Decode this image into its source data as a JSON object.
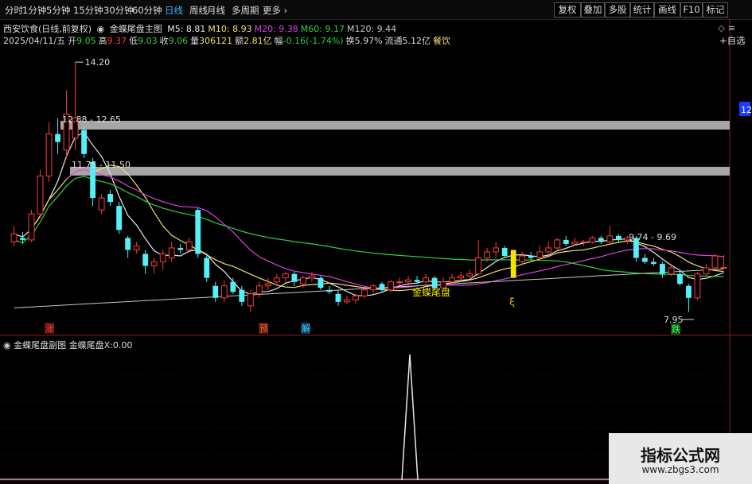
{
  "topbar": {
    "timeframes": [
      {
        "label": "分时",
        "active": false
      },
      {
        "label": "1分钟",
        "active": false
      },
      {
        "label": "5分钟",
        "active": false
      },
      {
        "label": "15分钟",
        "active": false
      },
      {
        "label": "30分钟",
        "active": false
      },
      {
        "label": "60分钟",
        "active": false
      },
      {
        "label": "日线",
        "active": true
      },
      {
        "label": "周线",
        "active": false
      },
      {
        "label": "月线",
        "active": false
      },
      {
        "label": "多周期",
        "active": false
      },
      {
        "label": "更多",
        "active": false
      }
    ],
    "buttons": [
      "复权",
      "叠加",
      "多股",
      "统计",
      "画线",
      "F10",
      "标记"
    ],
    "add_watch": "+自选"
  },
  "info": {
    "stock": "西安饮食(日线,前复权)",
    "indicator_main": "金蝶尾盘主图",
    "ma": [
      {
        "label": "M5:",
        "value": "8.81",
        "color": "#e8e8e8"
      },
      {
        "label": "M10:",
        "value": "8.93",
        "color": "#f0e070"
      },
      {
        "label": "M20:",
        "value": "9.38",
        "color": "#e040e0"
      },
      {
        "label": "M60:",
        "value": "9.17",
        "color": "#30d040"
      },
      {
        "label": "M120:",
        "value": "9.44",
        "color": "#c8c8c8"
      }
    ],
    "date": "2025/04/11/五",
    "open_label": "开",
    "open": "9.05",
    "high_label": "高",
    "high": "9.37",
    "low_label": "低",
    "low": "9.03",
    "close_label": "收",
    "close": "9.06",
    "vol_label": "量",
    "vol": "306121",
    "amt_label": "额",
    "amt": "2.81亿",
    "chg_label": "幅",
    "chg": "-0.16(-1.74%)",
    "turn_label": "换",
    "turn": "5.97%",
    "float_label": "流通",
    "float": "5.12亿",
    "sector": "餐饮"
  },
  "sub": {
    "title": "金蝶尾盘副图",
    "var": "金蝶尾盘X:",
    "value": "0.00"
  },
  "annotations": {
    "high_price": "14.20",
    "band1": "12.88 - 12.65",
    "band2": "11.75 - 11.50",
    "band3": "9.74 - 9.69",
    "low_price": "7.95",
    "signal": "金蝶尾盘",
    "tag_zhang": "涨",
    "tag_yu": "预",
    "tag_jie": "解",
    "tag_die": "跌",
    "right_axis": "12"
  },
  "colors": {
    "up": "#ff3b3b",
    "down": "#54f0f8",
    "band": "#a6a6a6",
    "ma5": "#e8e8e8",
    "ma10": "#f0e070",
    "ma20": "#e040e0",
    "ma60": "#30d040",
    "ma120": "#c8c8c8"
  },
  "watermark": {
    "line1": "指标公式网",
    "line2": "www.zbgs3.com"
  },
  "chart_data": {
    "type": "candlestick",
    "ylim": [
      7.6,
      14.6
    ],
    "candles": [
      [
        9.7,
        9.9,
        9.6,
        10.1
      ],
      [
        9.8,
        9.75,
        9.65,
        9.95
      ],
      [
        9.75,
        10.4,
        9.7,
        10.5
      ],
      [
        10.4,
        11.35,
        10.3,
        11.5
      ],
      [
        11.35,
        12.4,
        11.2,
        12.7
      ],
      [
        12.4,
        12.2,
        11.9,
        12.8
      ],
      [
        12.0,
        12.9,
        11.8,
        13.5
      ],
      [
        12.3,
        12.8,
        12.0,
        14.2
      ],
      [
        12.5,
        11.9,
        11.8,
        12.6
      ],
      [
        11.7,
        10.8,
        10.6,
        11.8
      ],
      [
        10.5,
        10.8,
        10.4,
        10.9
      ],
      [
        10.9,
        10.7,
        10.6,
        11.0
      ],
      [
        10.6,
        10.0,
        9.9,
        10.7
      ],
      [
        9.8,
        9.5,
        9.3,
        9.85
      ],
      [
        9.5,
        9.6,
        9.4,
        9.7
      ],
      [
        9.4,
        9.1,
        8.9,
        9.5
      ],
      [
        9.1,
        9.2,
        8.9,
        9.3
      ],
      [
        9.2,
        9.4,
        9.0,
        9.5
      ],
      [
        9.3,
        9.55,
        9.2,
        9.7
      ],
      [
        9.55,
        9.5,
        9.4,
        9.65
      ],
      [
        9.5,
        9.7,
        9.45,
        9.8
      ],
      [
        10.5,
        9.4,
        9.3,
        10.55
      ],
      [
        9.3,
        8.8,
        8.7,
        9.4
      ],
      [
        8.6,
        8.3,
        8.2,
        8.7
      ],
      [
        8.3,
        8.6,
        8.2,
        8.75
      ],
      [
        8.7,
        8.45,
        8.4,
        8.8
      ],
      [
        8.5,
        8.2,
        8.1,
        8.6
      ],
      [
        8.1,
        8.4,
        7.95,
        8.5
      ],
      [
        8.4,
        8.6,
        8.3,
        8.7
      ],
      [
        8.6,
        8.65,
        8.5,
        8.8
      ],
      [
        8.7,
        8.8,
        8.6,
        8.9
      ],
      [
        8.8,
        8.9,
        8.7,
        8.95
      ],
      [
        8.9,
        8.7,
        8.6,
        8.95
      ],
      [
        8.65,
        8.8,
        8.55,
        8.85
      ],
      [
        8.8,
        8.85,
        8.7,
        8.95
      ],
      [
        8.8,
        8.55,
        8.5,
        8.85
      ],
      [
        8.5,
        8.45,
        8.4,
        8.6
      ],
      [
        8.4,
        8.2,
        8.1,
        8.5
      ],
      [
        8.2,
        8.25,
        8.15,
        8.35
      ],
      [
        8.25,
        8.35,
        8.15,
        8.4
      ],
      [
        8.35,
        8.5,
        8.3,
        8.55
      ],
      [
        8.5,
        8.6,
        8.4,
        8.65
      ],
      [
        8.65,
        8.5,
        8.45,
        8.7
      ],
      [
        8.5,
        8.7,
        8.45,
        8.75
      ],
      [
        8.7,
        8.7,
        8.6,
        8.8
      ],
      [
        8.7,
        8.75,
        8.6,
        8.85
      ],
      [
        8.75,
        8.7,
        8.65,
        8.85
      ],
      [
        8.7,
        8.8,
        8.65,
        8.9
      ],
      [
        8.8,
        8.55,
        8.5,
        8.85
      ],
      [
        8.55,
        8.7,
        8.5,
        8.8
      ],
      [
        8.7,
        8.8,
        8.65,
        8.9
      ],
      [
        8.8,
        8.85,
        8.7,
        8.95
      ],
      [
        8.85,
        8.9,
        8.8,
        9.0
      ],
      [
        8.9,
        9.3,
        8.85,
        9.75
      ],
      [
        9.3,
        9.45,
        9.2,
        9.55
      ],
      [
        9.45,
        9.55,
        9.3,
        9.7
      ],
      [
        9.55,
        9.35,
        9.3,
        9.6
      ],
      [
        9.35,
        9.2,
        9.15,
        9.45
      ],
      [
        9.2,
        9.35,
        9.15,
        9.45
      ],
      [
        9.35,
        9.3,
        9.25,
        9.45
      ],
      [
        9.3,
        9.45,
        9.25,
        9.6
      ],
      [
        9.45,
        9.55,
        9.4,
        9.7
      ],
      [
        9.55,
        9.75,
        9.5,
        9.8
      ],
      [
        9.75,
        9.65,
        9.6,
        9.85
      ],
      [
        9.65,
        9.7,
        9.6,
        9.8
      ],
      [
        9.7,
        9.7,
        9.6,
        9.75
      ],
      [
        9.7,
        9.8,
        9.65,
        9.85
      ],
      [
        9.8,
        9.7,
        9.65,
        9.85
      ],
      [
        9.7,
        9.85,
        9.65,
        10.1
      ],
      [
        9.85,
        9.75,
        9.7,
        9.9
      ],
      [
        9.75,
        9.8,
        9.65,
        9.85
      ],
      [
        9.8,
        9.3,
        9.2,
        9.85
      ],
      [
        9.3,
        9.2,
        9.15,
        9.4
      ],
      [
        9.2,
        9.15,
        9.1,
        9.3
      ],
      [
        9.15,
        8.9,
        8.8,
        9.2
      ],
      [
        8.9,
        9.05,
        8.85,
        9.15
      ],
      [
        8.9,
        8.65,
        8.6,
        9.0
      ],
      [
        8.6,
        8.3,
        7.95,
        8.65
      ],
      [
        8.3,
        8.9,
        8.25,
        8.95
      ],
      [
        8.9,
        9.05,
        8.85,
        9.15
      ],
      [
        9.05,
        9.35,
        9.0,
        9.4
      ],
      [
        9.05,
        9.06,
        9.03,
        9.37
      ]
    ],
    "signal_index": 57,
    "sub_signal_x": 57,
    "sub_values": [
      0,
      1,
      0
    ]
  }
}
